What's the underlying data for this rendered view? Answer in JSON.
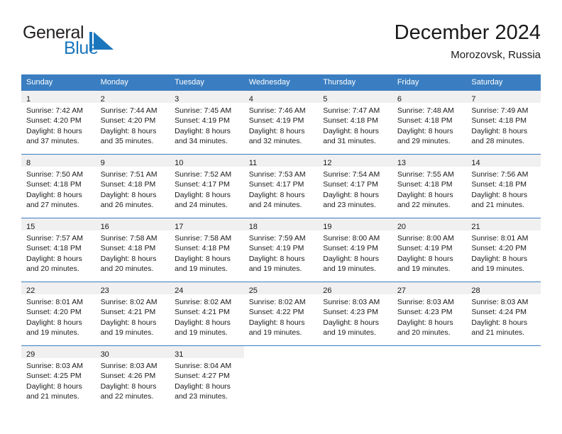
{
  "brand": {
    "name_part1": "General",
    "name_part2": "Blue",
    "flag_color": "#1b76bc",
    "text_color": "#231f20"
  },
  "header": {
    "title": "December 2024",
    "subtitle": "Morozovsk, Russia"
  },
  "theme": {
    "header_row_bg": "#3a7ec1",
    "header_row_text": "#ffffff",
    "date_band_bg": "#f0f0f0",
    "cell_bg": "#ffffff",
    "text": "#1a1a1a"
  },
  "weekdays": [
    "Sunday",
    "Monday",
    "Tuesday",
    "Wednesday",
    "Thursday",
    "Friday",
    "Saturday"
  ],
  "weeks": [
    [
      {
        "date": "1",
        "sunrise": "Sunrise: 7:42 AM",
        "sunset": "Sunset: 4:20 PM",
        "daylight_line1": "Daylight: 8 hours",
        "daylight_line2": "and 37 minutes."
      },
      {
        "date": "2",
        "sunrise": "Sunrise: 7:44 AM",
        "sunset": "Sunset: 4:20 PM",
        "daylight_line1": "Daylight: 8 hours",
        "daylight_line2": "and 35 minutes."
      },
      {
        "date": "3",
        "sunrise": "Sunrise: 7:45 AM",
        "sunset": "Sunset: 4:19 PM",
        "daylight_line1": "Daylight: 8 hours",
        "daylight_line2": "and 34 minutes."
      },
      {
        "date": "4",
        "sunrise": "Sunrise: 7:46 AM",
        "sunset": "Sunset: 4:19 PM",
        "daylight_line1": "Daylight: 8 hours",
        "daylight_line2": "and 32 minutes."
      },
      {
        "date": "5",
        "sunrise": "Sunrise: 7:47 AM",
        "sunset": "Sunset: 4:18 PM",
        "daylight_line1": "Daylight: 8 hours",
        "daylight_line2": "and 31 minutes."
      },
      {
        "date": "6",
        "sunrise": "Sunrise: 7:48 AM",
        "sunset": "Sunset: 4:18 PM",
        "daylight_line1": "Daylight: 8 hours",
        "daylight_line2": "and 29 minutes."
      },
      {
        "date": "7",
        "sunrise": "Sunrise: 7:49 AM",
        "sunset": "Sunset: 4:18 PM",
        "daylight_line1": "Daylight: 8 hours",
        "daylight_line2": "and 28 minutes."
      }
    ],
    [
      {
        "date": "8",
        "sunrise": "Sunrise: 7:50 AM",
        "sunset": "Sunset: 4:18 PM",
        "daylight_line1": "Daylight: 8 hours",
        "daylight_line2": "and 27 minutes."
      },
      {
        "date": "9",
        "sunrise": "Sunrise: 7:51 AM",
        "sunset": "Sunset: 4:18 PM",
        "daylight_line1": "Daylight: 8 hours",
        "daylight_line2": "and 26 minutes."
      },
      {
        "date": "10",
        "sunrise": "Sunrise: 7:52 AM",
        "sunset": "Sunset: 4:17 PM",
        "daylight_line1": "Daylight: 8 hours",
        "daylight_line2": "and 24 minutes."
      },
      {
        "date": "11",
        "sunrise": "Sunrise: 7:53 AM",
        "sunset": "Sunset: 4:17 PM",
        "daylight_line1": "Daylight: 8 hours",
        "daylight_line2": "and 24 minutes."
      },
      {
        "date": "12",
        "sunrise": "Sunrise: 7:54 AM",
        "sunset": "Sunset: 4:17 PM",
        "daylight_line1": "Daylight: 8 hours",
        "daylight_line2": "and 23 minutes."
      },
      {
        "date": "13",
        "sunrise": "Sunrise: 7:55 AM",
        "sunset": "Sunset: 4:18 PM",
        "daylight_line1": "Daylight: 8 hours",
        "daylight_line2": "and 22 minutes."
      },
      {
        "date": "14",
        "sunrise": "Sunrise: 7:56 AM",
        "sunset": "Sunset: 4:18 PM",
        "daylight_line1": "Daylight: 8 hours",
        "daylight_line2": "and 21 minutes."
      }
    ],
    [
      {
        "date": "15",
        "sunrise": "Sunrise: 7:57 AM",
        "sunset": "Sunset: 4:18 PM",
        "daylight_line1": "Daylight: 8 hours",
        "daylight_line2": "and 20 minutes."
      },
      {
        "date": "16",
        "sunrise": "Sunrise: 7:58 AM",
        "sunset": "Sunset: 4:18 PM",
        "daylight_line1": "Daylight: 8 hours",
        "daylight_line2": "and 20 minutes."
      },
      {
        "date": "17",
        "sunrise": "Sunrise: 7:58 AM",
        "sunset": "Sunset: 4:18 PM",
        "daylight_line1": "Daylight: 8 hours",
        "daylight_line2": "and 19 minutes."
      },
      {
        "date": "18",
        "sunrise": "Sunrise: 7:59 AM",
        "sunset": "Sunset: 4:19 PM",
        "daylight_line1": "Daylight: 8 hours",
        "daylight_line2": "and 19 minutes."
      },
      {
        "date": "19",
        "sunrise": "Sunrise: 8:00 AM",
        "sunset": "Sunset: 4:19 PM",
        "daylight_line1": "Daylight: 8 hours",
        "daylight_line2": "and 19 minutes."
      },
      {
        "date": "20",
        "sunrise": "Sunrise: 8:00 AM",
        "sunset": "Sunset: 4:19 PM",
        "daylight_line1": "Daylight: 8 hours",
        "daylight_line2": "and 19 minutes."
      },
      {
        "date": "21",
        "sunrise": "Sunrise: 8:01 AM",
        "sunset": "Sunset: 4:20 PM",
        "daylight_line1": "Daylight: 8 hours",
        "daylight_line2": "and 19 minutes."
      }
    ],
    [
      {
        "date": "22",
        "sunrise": "Sunrise: 8:01 AM",
        "sunset": "Sunset: 4:20 PM",
        "daylight_line1": "Daylight: 8 hours",
        "daylight_line2": "and 19 minutes."
      },
      {
        "date": "23",
        "sunrise": "Sunrise: 8:02 AM",
        "sunset": "Sunset: 4:21 PM",
        "daylight_line1": "Daylight: 8 hours",
        "daylight_line2": "and 19 minutes."
      },
      {
        "date": "24",
        "sunrise": "Sunrise: 8:02 AM",
        "sunset": "Sunset: 4:21 PM",
        "daylight_line1": "Daylight: 8 hours",
        "daylight_line2": "and 19 minutes."
      },
      {
        "date": "25",
        "sunrise": "Sunrise: 8:02 AM",
        "sunset": "Sunset: 4:22 PM",
        "daylight_line1": "Daylight: 8 hours",
        "daylight_line2": "and 19 minutes."
      },
      {
        "date": "26",
        "sunrise": "Sunrise: 8:03 AM",
        "sunset": "Sunset: 4:23 PM",
        "daylight_line1": "Daylight: 8 hours",
        "daylight_line2": "and 19 minutes."
      },
      {
        "date": "27",
        "sunrise": "Sunrise: 8:03 AM",
        "sunset": "Sunset: 4:23 PM",
        "daylight_line1": "Daylight: 8 hours",
        "daylight_line2": "and 20 minutes."
      },
      {
        "date": "28",
        "sunrise": "Sunrise: 8:03 AM",
        "sunset": "Sunset: 4:24 PM",
        "daylight_line1": "Daylight: 8 hours",
        "daylight_line2": "and 21 minutes."
      }
    ],
    [
      {
        "date": "29",
        "sunrise": "Sunrise: 8:03 AM",
        "sunset": "Sunset: 4:25 PM",
        "daylight_line1": "Daylight: 8 hours",
        "daylight_line2": "and 21 minutes."
      },
      {
        "date": "30",
        "sunrise": "Sunrise: 8:03 AM",
        "sunset": "Sunset: 4:26 PM",
        "daylight_line1": "Daylight: 8 hours",
        "daylight_line2": "and 22 minutes."
      },
      {
        "date": "31",
        "sunrise": "Sunrise: 8:04 AM",
        "sunset": "Sunset: 4:27 PM",
        "daylight_line1": "Daylight: 8 hours",
        "daylight_line2": "and 23 minutes."
      },
      {
        "date": "",
        "sunrise": "",
        "sunset": "",
        "daylight_line1": "",
        "daylight_line2": ""
      },
      {
        "date": "",
        "sunrise": "",
        "sunset": "",
        "daylight_line1": "",
        "daylight_line2": ""
      },
      {
        "date": "",
        "sunrise": "",
        "sunset": "",
        "daylight_line1": "",
        "daylight_line2": ""
      },
      {
        "date": "",
        "sunrise": "",
        "sunset": "",
        "daylight_line1": "",
        "daylight_line2": ""
      }
    ]
  ]
}
